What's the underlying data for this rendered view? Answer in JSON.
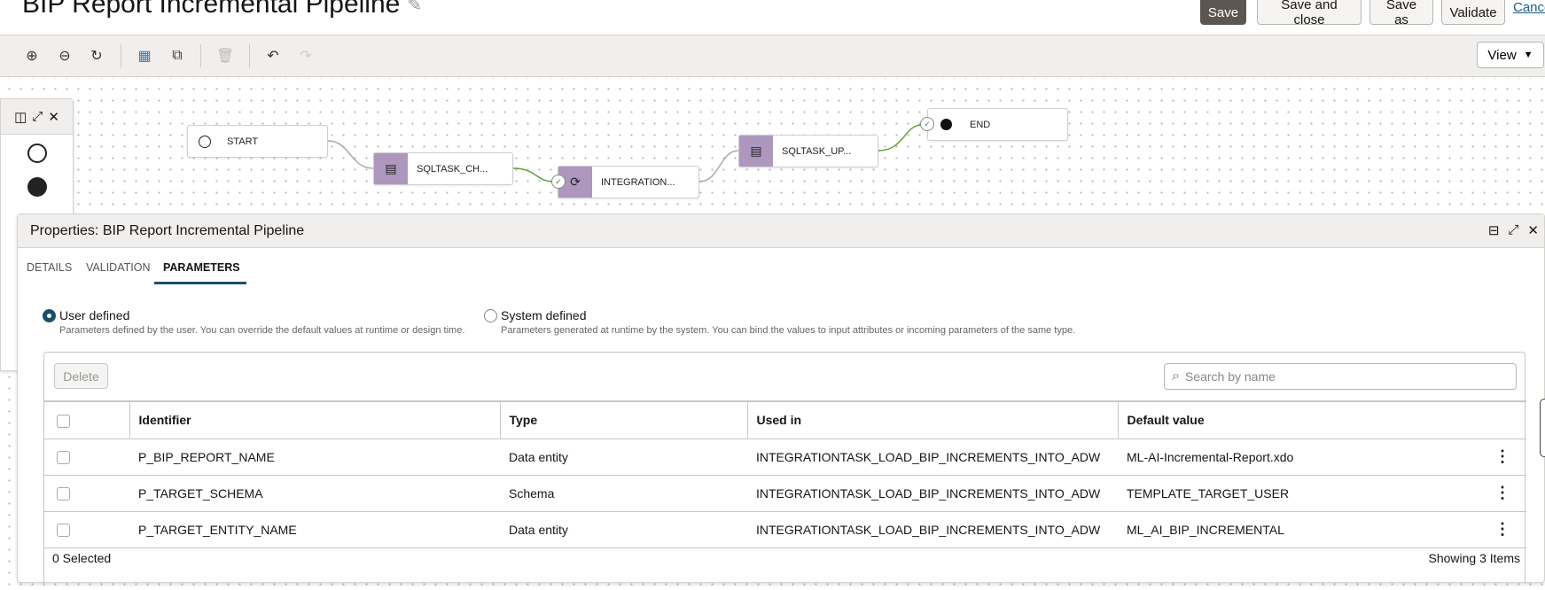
{
  "header": {
    "title": "BIP Report Incremental Pipeline",
    "edit_icon": "pencil-icon",
    "buttons": {
      "save": "Save",
      "save_and_close": "Save and close",
      "save_as": "Save as",
      "validate": "Validate",
      "cancel": "Cancel"
    }
  },
  "toolbar": {
    "icons": [
      "zoom-in-icon",
      "zoom-out-icon",
      "reset-icon",
      "grid-icon",
      "copy-icon",
      "delete-icon",
      "undo-icon",
      "redo-icon"
    ],
    "view_label": "View"
  },
  "canvas": {
    "nodes": [
      {
        "label": "START"
      },
      {
        "label": "SQLTASK_CH..."
      },
      {
        "label": "INTEGRATION..."
      },
      {
        "label": "SQLTASK_UP..."
      },
      {
        "label": "END"
      }
    ]
  },
  "properties": {
    "title": "Properties: BIP Report Incremental Pipeline",
    "tabs": [
      "DETAILS",
      "VALIDATION",
      "PARAMETERS"
    ],
    "active_tab": "PARAMETERS",
    "user_defined": {
      "label": "User defined",
      "description": "Parameters defined by the user. You can override the default values at runtime or design time.",
      "selected": true
    },
    "system_defined": {
      "label": "System defined",
      "description": "Parameters generated at runtime by the system. You can bind the values to input attributes or incoming parameters of the same type.",
      "selected": false
    },
    "delete_label": "Delete",
    "search_placeholder": "Search by name",
    "columns": [
      "Identifier",
      "Type",
      "Used in",
      "Default value"
    ],
    "rows": [
      {
        "identifier": "P_BIP_REPORT_NAME",
        "type": "Data entity",
        "used_in": "INTEGRATIONTASK_LOAD_BIP_INCREMENTS_INTO_ADW",
        "default": "ML-AI-Incremental-Report.xdo"
      },
      {
        "identifier": "P_TARGET_SCHEMA",
        "type": "Schema",
        "used_in": "INTEGRATIONTASK_LOAD_BIP_INCREMENTS_INTO_ADW",
        "default": "TEMPLATE_TARGET_USER"
      },
      {
        "identifier": "P_TARGET_ENTITY_NAME",
        "type": "Data entity",
        "used_in": "INTEGRATIONTASK_LOAD_BIP_INCREMENTS_INTO_ADW",
        "default": "ML_AI_BIP_INCREMENTAL"
      }
    ],
    "selected_count": "0 Selected",
    "showing": "Showing 3 Items"
  }
}
